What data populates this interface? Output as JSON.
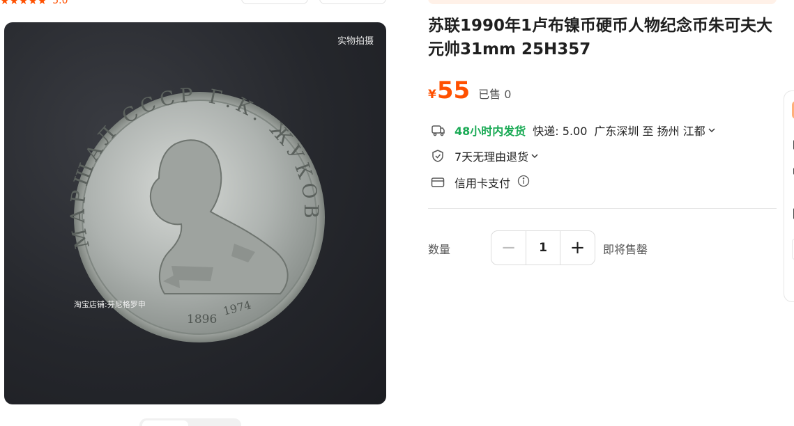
{
  "header": {
    "rating_stars": "★★★★★",
    "rating_score": "5.0"
  },
  "gallery": {
    "photo_tag": "实物拍摄",
    "watermark": "淘宝店铺:芬尼格罗申",
    "coin_inscription": "МАРШАЛ СССР Г.К. ЖУКОВ",
    "coin_years": [
      "1896",
      "1974"
    ]
  },
  "product": {
    "title": "苏联1990年1卢布镍币硬币人物纪念币朱可夫大元帅31mm 25H357",
    "currency": "¥",
    "price": "55",
    "sold": "已售 0",
    "shipping": {
      "fast_ship": "48小时内发货",
      "fee": "快递: 5.00",
      "route": "广东深圳 至 扬州 江都"
    },
    "returns": "7天无理由退货",
    "payment": "信用卡支付"
  },
  "quantity": {
    "label": "数量",
    "minus": "−",
    "value": "1",
    "plus": "+",
    "stock_status": "即将售罄"
  },
  "colors": {
    "accent": "#ff5000",
    "green": "#1aaa55"
  }
}
